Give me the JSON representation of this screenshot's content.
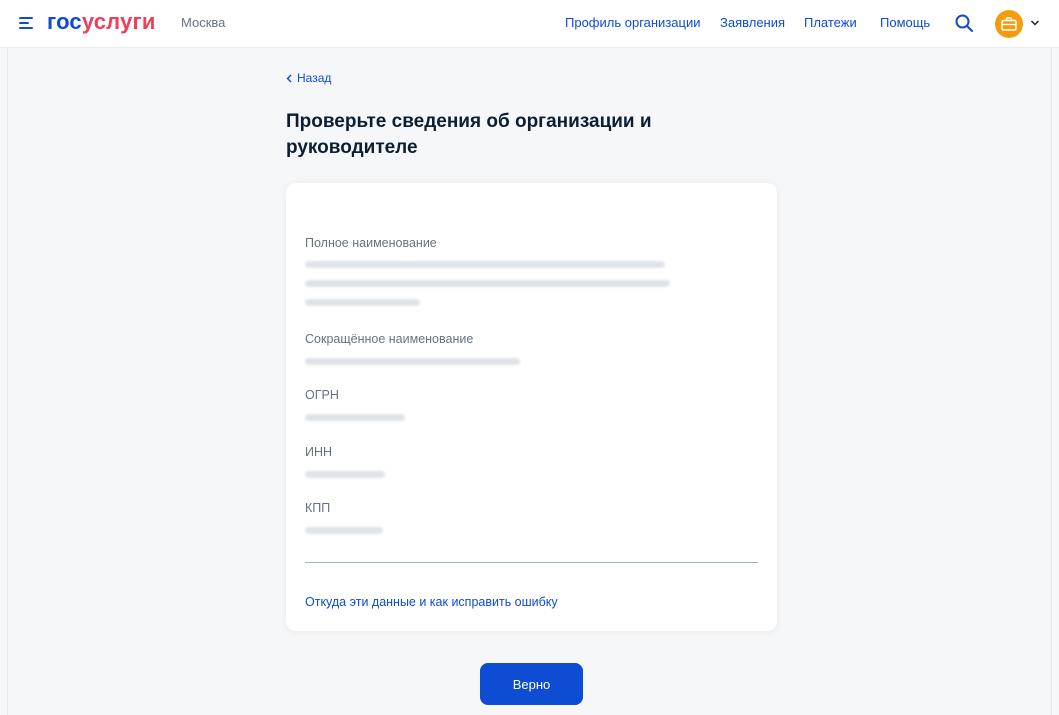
{
  "header": {
    "logo_part1": "гос",
    "logo_part2": "услуги",
    "city": "Москва",
    "nav": [
      "Профиль организации",
      "Заявления",
      "Платежи",
      "Помощь"
    ]
  },
  "back_label": "Назад",
  "page_title": "Проверьте сведения об организации и руководителе",
  "fields": [
    {
      "label": "Полное наименование"
    },
    {
      "label": "Сокращённое наименование"
    },
    {
      "label": "ОГРН"
    },
    {
      "label": "ИНН"
    },
    {
      "label": "КПП"
    }
  ],
  "help_link": "Откуда эти данные и как исправить ошибку",
  "confirm_button": "Верно",
  "colors": {
    "primary": "#0d4cd3",
    "logo_accent": "#ee3f58",
    "avatar": "#f39c12"
  }
}
